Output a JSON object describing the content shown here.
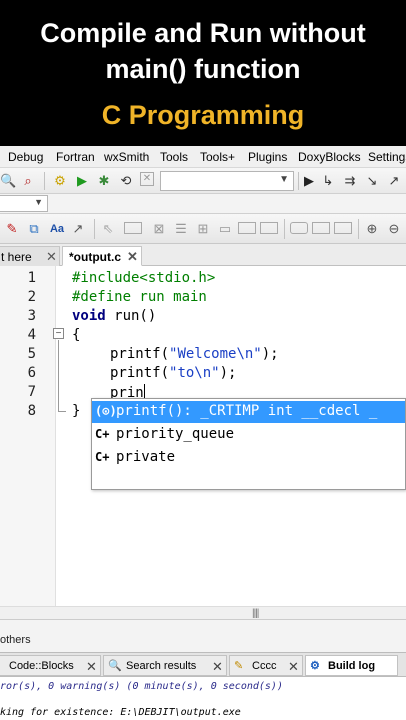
{
  "banner": {
    "line1": "Compile and Run without",
    "line2": "main() function",
    "subtitle": "C Programming"
  },
  "menu": [
    "Debug",
    "Fortran",
    "wxSmith",
    "Tools",
    "Tools+",
    "Plugins",
    "DoxyBlocks",
    "Settings"
  ],
  "tabs": {
    "prev": "t here",
    "active": "*output.c"
  },
  "editor": {
    "line_numbers": [
      "1",
      "2",
      "3",
      "4",
      "5",
      "6",
      "7",
      "8"
    ],
    "lines": {
      "l1": "#include<stdio.h>",
      "l2": "#define run main",
      "l3_kw": "void",
      "l3_rest": " run()",
      "l4": "{",
      "l5_fn": "printf(",
      "l5_str": "\"Welcome\\n\"",
      "l5_end": ");",
      "l6_fn": "printf(",
      "l6_str": "\"to\\n\"",
      "l6_end": ");",
      "l7": "prin",
      "l8": "}"
    },
    "autocomplete": [
      {
        "icon": "(⊙)",
        "text": "printf(): _CRTIMP int __cdecl _"
      },
      {
        "icon": "C+",
        "text": "priority_queue"
      },
      {
        "icon": "C+",
        "text": "private"
      }
    ]
  },
  "bottom": {
    "others_label": "others",
    "log_tabs": [
      "Code::Blocks",
      "Search results",
      "Cccc",
      "Build log"
    ],
    "log_lines": [
      "ror(s), 0 warning(s) (0 minute(s), 0 second(s))",
      "king for existence: E:\\DEBJIT\\output.exe"
    ]
  }
}
